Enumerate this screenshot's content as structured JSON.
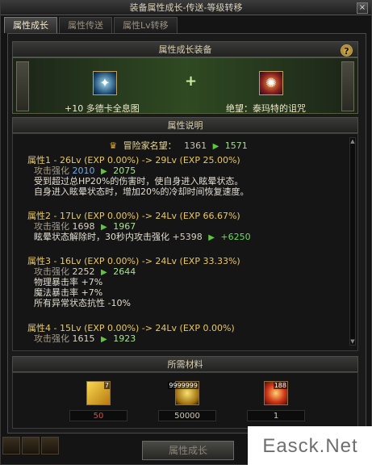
{
  "window": {
    "title": "装备属性成长-传送-等级转移",
    "close_glyph": "×"
  },
  "tabs": [
    {
      "label": "属性成长",
      "active": true
    },
    {
      "label": "属性传送",
      "active": false
    },
    {
      "label": "属性Lv转移",
      "active": false
    }
  ],
  "equip_section": {
    "header": "属性成长装备",
    "help_glyph": "?",
    "plus": "+",
    "left_item": {
      "prefix": "+10",
      "name": "多德卡全息图"
    },
    "right_item": {
      "name": "绝望：泰玛特的诅咒"
    }
  },
  "desc_section": {
    "header": "属性说明",
    "fame": {
      "label": "冒险家名望：",
      "from": "1361",
      "to": "1571"
    },
    "attributes": [
      {
        "title": "属性1 - 26Lv (EXP 0.00%) -> 29Lv (EXP 25.00%)",
        "stat_label": "攻击强化",
        "stat_from": "2010",
        "stat_to": "2075",
        "lines": [
          "受到超过总HP20%的伤害时，使自身进入眩晕状态。",
          "自身进入眩晕状态时，增加20%的冷却时间恢复速度。"
        ]
      },
      {
        "title": "属性2 - 17Lv (EXP 0.00%) -> 24Lv (EXP 66.67%)",
        "stat_label": "攻击强化",
        "stat_from": "1698",
        "stat_to": "1967",
        "extra_label": "眩晕状态解除时，30秒内攻击强化",
        "extra_from": "+5398",
        "extra_to": "+6250"
      },
      {
        "title": "属性3 - 16Lv (EXP 0.00%) -> 24Lv (EXP 33.33%)",
        "stat_label": "攻击强化",
        "stat_from": "2252",
        "stat_to": "2644",
        "lines": [
          "物理暴击率 +7%",
          "魔法暴击率 +7%",
          "所有异常状态抗性 -10%"
        ]
      },
      {
        "title": "属性4 - 15Lv (EXP 0.00%) -> 24Lv (EXP 0.00%)",
        "stat_label": "攻击强化",
        "stat_from": "1615",
        "stat_to": "1923"
      }
    ]
  },
  "materials_section": {
    "header": "所需材料",
    "items": [
      {
        "badge": "7",
        "count": "50",
        "icon": "golden-crystal-icon",
        "insufficient": true
      },
      {
        "badge": "9999999",
        "count": "50000",
        "icon": "gold-coins-icon",
        "insufficient": false
      },
      {
        "badge": "188",
        "count": "1",
        "icon": "red-orb-icon",
        "insufficient": false
      }
    ]
  },
  "action_button": {
    "label": "属性成长"
  },
  "watermark": {
    "text": "Easck.Net"
  },
  "colors": {
    "accent_gold": "#e8c860",
    "increase_green": "#5fc83a",
    "insufficient_red": "#e04838"
  }
}
